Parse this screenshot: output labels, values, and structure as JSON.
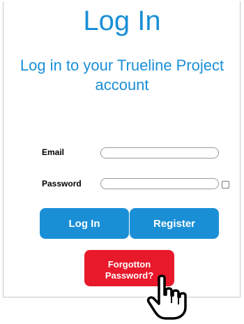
{
  "header": {
    "title": "Log In",
    "subtitle": "Log in to your Trueline Project account"
  },
  "form": {
    "email_label": "Email",
    "email_value": "",
    "password_label": "Password",
    "password_value": "",
    "checkbox_checked": false
  },
  "buttons": {
    "login_label": "Log In",
    "register_label": "Register",
    "forgot_line1": "Forgotton",
    "forgot_line2": "Password?"
  },
  "colors": {
    "accent_blue": "#1a8fd6",
    "danger_red": "#e8192b"
  },
  "icons": {
    "cursor": "hand-pointer-icon"
  }
}
